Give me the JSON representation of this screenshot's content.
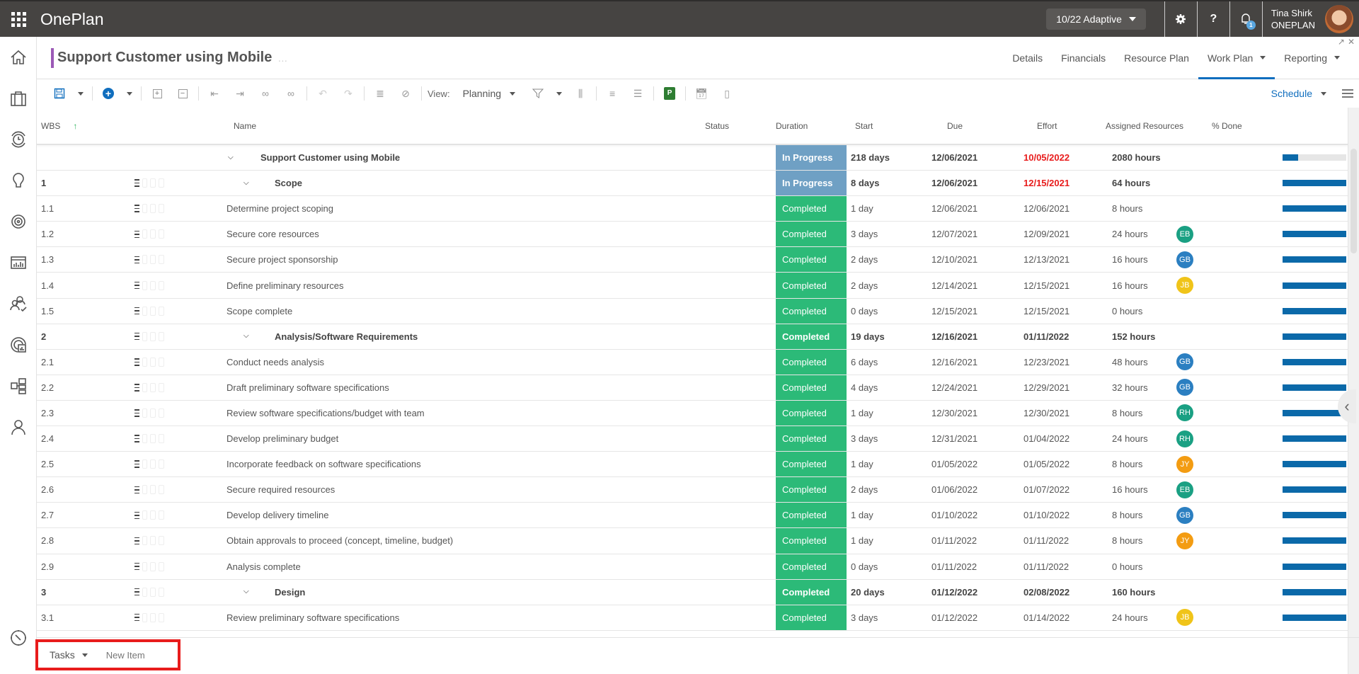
{
  "topbar": {
    "app_title": "OnePlan",
    "context_selector": "10/22 Adaptive",
    "user_name": "Tina Shirk",
    "user_org": "ONEPLAN",
    "notification_count": "1",
    "help_label": "?"
  },
  "sidebar": {
    "items": [
      "home-icon",
      "portfolio-icon",
      "timesheet-icon",
      "ideas-icon",
      "goals-icon",
      "reports-icon",
      "resources-icon",
      "analytics-icon",
      "org-chart-icon",
      "profile-icon"
    ],
    "bottom": "compass-icon"
  },
  "header": {
    "title": "Support Customer using Mobile",
    "more": "…",
    "tabs": [
      {
        "label": "Details",
        "active": false,
        "dropdown": false
      },
      {
        "label": "Financials",
        "active": false,
        "dropdown": false
      },
      {
        "label": "Resource Plan",
        "active": false,
        "dropdown": false
      },
      {
        "label": "Work Plan",
        "active": true,
        "dropdown": true
      },
      {
        "label": "Reporting",
        "active": false,
        "dropdown": true
      }
    ]
  },
  "toolbar": {
    "view_label": "View:",
    "view_value": "Planning",
    "schedule_label": "Schedule",
    "msproject_label": "P"
  },
  "grid": {
    "columns": [
      "WBS",
      "Name",
      "Status",
      "Duration",
      "Start",
      "Due",
      "Effort",
      "Assigned Resources",
      "% Done"
    ],
    "sort_column": "WBS",
    "sort_direction": "ascending",
    "status_colors": {
      "In Progress": "#6fa0c4",
      "Completed": "#2cba78"
    },
    "rows": [
      {
        "wbs": "",
        "name": "Support Customer using Mobile",
        "level": 0,
        "summary": true,
        "expanded": true,
        "status": "In Progress",
        "duration": "218 days",
        "start": "12/06/2021",
        "due": "10/05/2022",
        "due_overdue": true,
        "effort": "2080 hours",
        "resource": "",
        "pct": 24
      },
      {
        "wbs": "1",
        "name": "Scope",
        "level": 1,
        "summary": true,
        "expanded": true,
        "status": "In Progress",
        "duration": "8 days",
        "start": "12/06/2021",
        "due": "12/15/2021",
        "due_overdue": true,
        "effort": "64 hours",
        "resource": "",
        "pct": 100
      },
      {
        "wbs": "1.1",
        "name": "Determine project scoping",
        "level": 2,
        "summary": false,
        "status": "Completed",
        "duration": "1 day",
        "start": "12/06/2021",
        "due": "12/06/2021",
        "due_overdue": false,
        "effort": "8 hours",
        "resource": "",
        "pct": 100
      },
      {
        "wbs": "1.2",
        "name": "Secure core resources",
        "level": 2,
        "summary": false,
        "status": "Completed",
        "duration": "3 days",
        "start": "12/07/2021",
        "due": "12/09/2021",
        "due_overdue": false,
        "effort": "24 hours",
        "resource": "EB",
        "pct": 100
      },
      {
        "wbs": "1.3",
        "name": "Secure project sponsorship",
        "level": 2,
        "summary": false,
        "status": "Completed",
        "duration": "2 days",
        "start": "12/10/2021",
        "due": "12/13/2021",
        "due_overdue": false,
        "effort": "16 hours",
        "resource": "GB",
        "pct": 100
      },
      {
        "wbs": "1.4",
        "name": "Define preliminary resources",
        "level": 2,
        "summary": false,
        "status": "Completed",
        "duration": "2 days",
        "start": "12/14/2021",
        "due": "12/15/2021",
        "due_overdue": false,
        "effort": "16 hours",
        "resource": "JB",
        "pct": 100
      },
      {
        "wbs": "1.5",
        "name": "Scope complete",
        "level": 2,
        "summary": false,
        "status": "Completed",
        "duration": "0 days",
        "start": "12/15/2021",
        "due": "12/15/2021",
        "due_overdue": false,
        "effort": "0 hours",
        "resource": "",
        "pct": 100
      },
      {
        "wbs": "2",
        "name": "Analysis/Software Requirements",
        "level": 1,
        "summary": true,
        "expanded": true,
        "status": "Completed",
        "duration": "19 days",
        "start": "12/16/2021",
        "due": "01/11/2022",
        "due_overdue": false,
        "effort": "152 hours",
        "resource": "",
        "pct": 100
      },
      {
        "wbs": "2.1",
        "name": "Conduct needs analysis",
        "level": 2,
        "summary": false,
        "status": "Completed",
        "duration": "6 days",
        "start": "12/16/2021",
        "due": "12/23/2021",
        "due_overdue": false,
        "effort": "48 hours",
        "resource": "GB",
        "pct": 100
      },
      {
        "wbs": "2.2",
        "name": "Draft preliminary software specifications",
        "level": 2,
        "summary": false,
        "status": "Completed",
        "duration": "4 days",
        "start": "12/24/2021",
        "due": "12/29/2021",
        "due_overdue": false,
        "effort": "32 hours",
        "resource": "GB",
        "pct": 100
      },
      {
        "wbs": "2.3",
        "name": "Review software specifications/budget with team",
        "level": 2,
        "summary": false,
        "status": "Completed",
        "duration": "1 day",
        "start": "12/30/2021",
        "due": "12/30/2021",
        "due_overdue": false,
        "effort": "8 hours",
        "resource": "RH",
        "pct": 100
      },
      {
        "wbs": "2.4",
        "name": "Develop preliminary budget",
        "level": 2,
        "summary": false,
        "status": "Completed",
        "duration": "3 days",
        "start": "12/31/2021",
        "due": "01/04/2022",
        "due_overdue": false,
        "effort": "24 hours",
        "resource": "RH",
        "pct": 100
      },
      {
        "wbs": "2.5",
        "name": "Incorporate feedback on software specifications",
        "level": 2,
        "summary": false,
        "status": "Completed",
        "duration": "1 day",
        "start": "01/05/2022",
        "due": "01/05/2022",
        "due_overdue": false,
        "effort": "8 hours",
        "resource": "JY",
        "pct": 100
      },
      {
        "wbs": "2.6",
        "name": "Secure required resources",
        "level": 2,
        "summary": false,
        "status": "Completed",
        "duration": "2 days",
        "start": "01/06/2022",
        "due": "01/07/2022",
        "due_overdue": false,
        "effort": "16 hours",
        "resource": "EB",
        "pct": 100
      },
      {
        "wbs": "2.7",
        "name": "Develop delivery timeline",
        "level": 2,
        "summary": false,
        "status": "Completed",
        "duration": "1 day",
        "start": "01/10/2022",
        "due": "01/10/2022",
        "due_overdue": false,
        "effort": "8 hours",
        "resource": "GB",
        "pct": 100
      },
      {
        "wbs": "2.8",
        "name": "Obtain approvals to proceed (concept, timeline, budget)",
        "level": 2,
        "summary": false,
        "status": "Completed",
        "duration": "1 day",
        "start": "01/11/2022",
        "due": "01/11/2022",
        "due_overdue": false,
        "effort": "8 hours",
        "resource": "JY",
        "pct": 100
      },
      {
        "wbs": "2.9",
        "name": "Analysis complete",
        "level": 2,
        "summary": false,
        "status": "Completed",
        "duration": "0 days",
        "start": "01/11/2022",
        "due": "01/11/2022",
        "due_overdue": false,
        "effort": "0 hours",
        "resource": "",
        "pct": 100
      },
      {
        "wbs": "3",
        "name": "Design",
        "level": 1,
        "summary": true,
        "expanded": true,
        "status": "Completed",
        "duration": "20 days",
        "start": "01/12/2022",
        "due": "02/08/2022",
        "due_overdue": false,
        "effort": "160 hours",
        "resource": "",
        "pct": 100
      },
      {
        "wbs": "3.1",
        "name": "Review preliminary software specifications",
        "level": 2,
        "summary": false,
        "status": "Completed",
        "duration": "3 days",
        "start": "01/12/2022",
        "due": "01/14/2022",
        "due_overdue": false,
        "effort": "24 hours",
        "resource": "JB",
        "pct": 100
      }
    ],
    "resource_colors": {
      "EB": "#1aa083",
      "GB": "#2b7fc1",
      "JB": "#f0c419",
      "RH": "#1aa083",
      "JY": "#f39c12"
    }
  },
  "bottom": {
    "tasks_label": "Tasks",
    "new_item_label": "New Item"
  }
}
